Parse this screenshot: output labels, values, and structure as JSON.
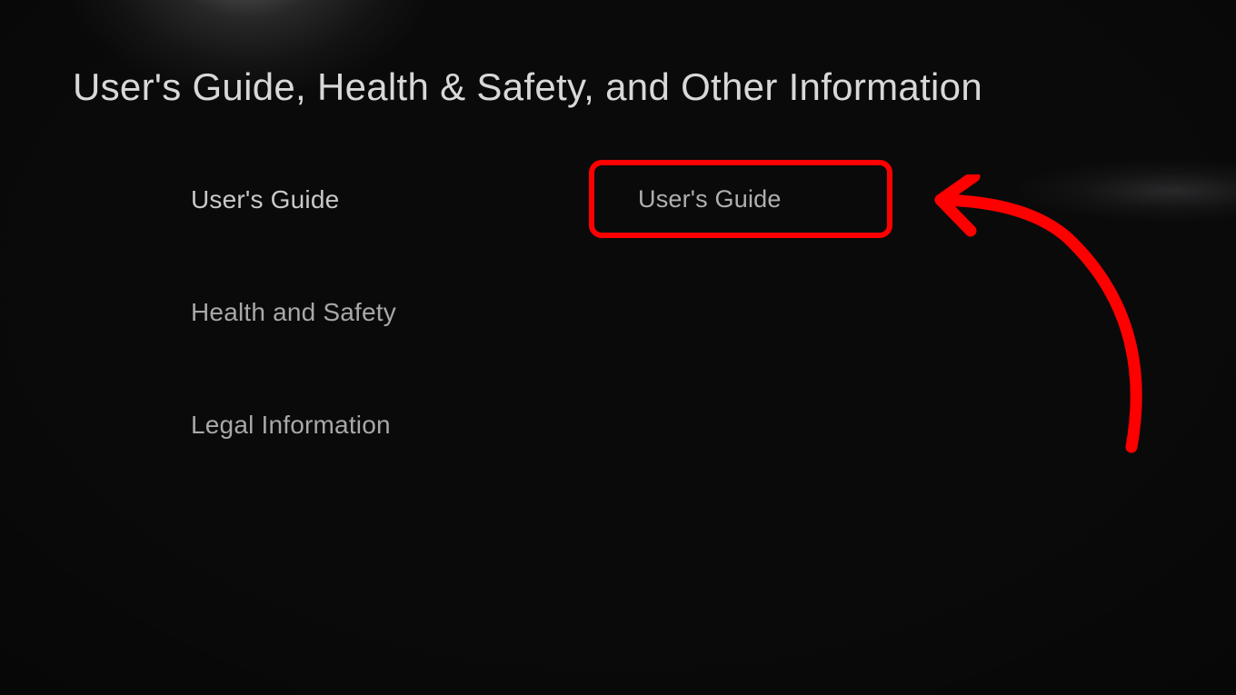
{
  "header": {
    "title": "User's Guide, Health & Safety, and Other Information"
  },
  "sidebar": {
    "items": [
      {
        "label": "User's Guide",
        "selected": true
      },
      {
        "label": "Health and Safety",
        "selected": false
      },
      {
        "label": "Legal Information",
        "selected": false
      }
    ]
  },
  "content": {
    "button_label": "User's Guide"
  },
  "annotation": {
    "highlight_color": "#ff0000",
    "arrow_color": "#ff0000"
  }
}
